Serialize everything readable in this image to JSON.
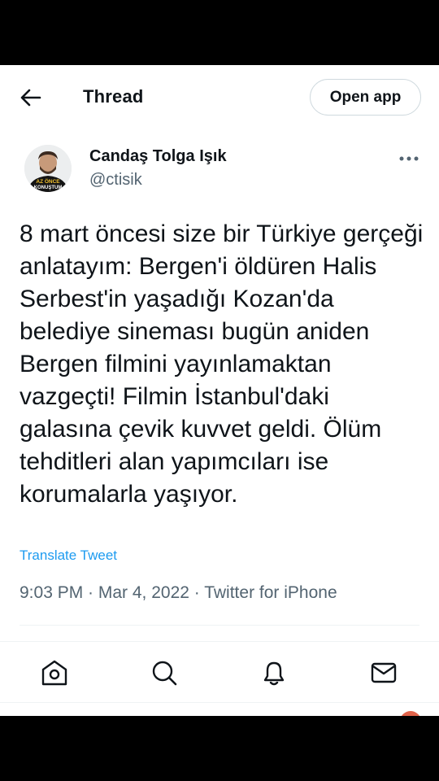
{
  "header": {
    "title": "Thread",
    "open_app_label": "Open app",
    "back_icon": "arrow-left-icon"
  },
  "tweet": {
    "author_name": "Candaş Tolga Işık",
    "author_handle": "@ctisik",
    "avatar_text": "AZ ÖNCE KONUŞTUM",
    "text": "8 mart öncesi size bir Türkiye gerçeği anlatayım: Bergen'i öldüren Halis Serbest'in yaşadığı Kozan'da belediye sineması bugün aniden Bergen filmini yayınlamaktan vazgeçti! Filmin İstanbul'daki galasına çevik kuvvet geldi. Ölüm tehditleri alan yapımcıları ise korumalarla yaşıyor.",
    "translate_label": "Translate Tweet",
    "meta": "9:03 PM · Mar 4, 2022 · Twitter for iPhone"
  },
  "nav": {
    "items": [
      {
        "name": "home-icon"
      },
      {
        "name": "search-icon"
      },
      {
        "name": "bell-icon"
      },
      {
        "name": "mail-icon"
      }
    ]
  },
  "colors": {
    "link": "#1d9bf0",
    "secondary_text": "#536471",
    "border": "#cfd9de",
    "notification_dot": "#e0634a"
  }
}
